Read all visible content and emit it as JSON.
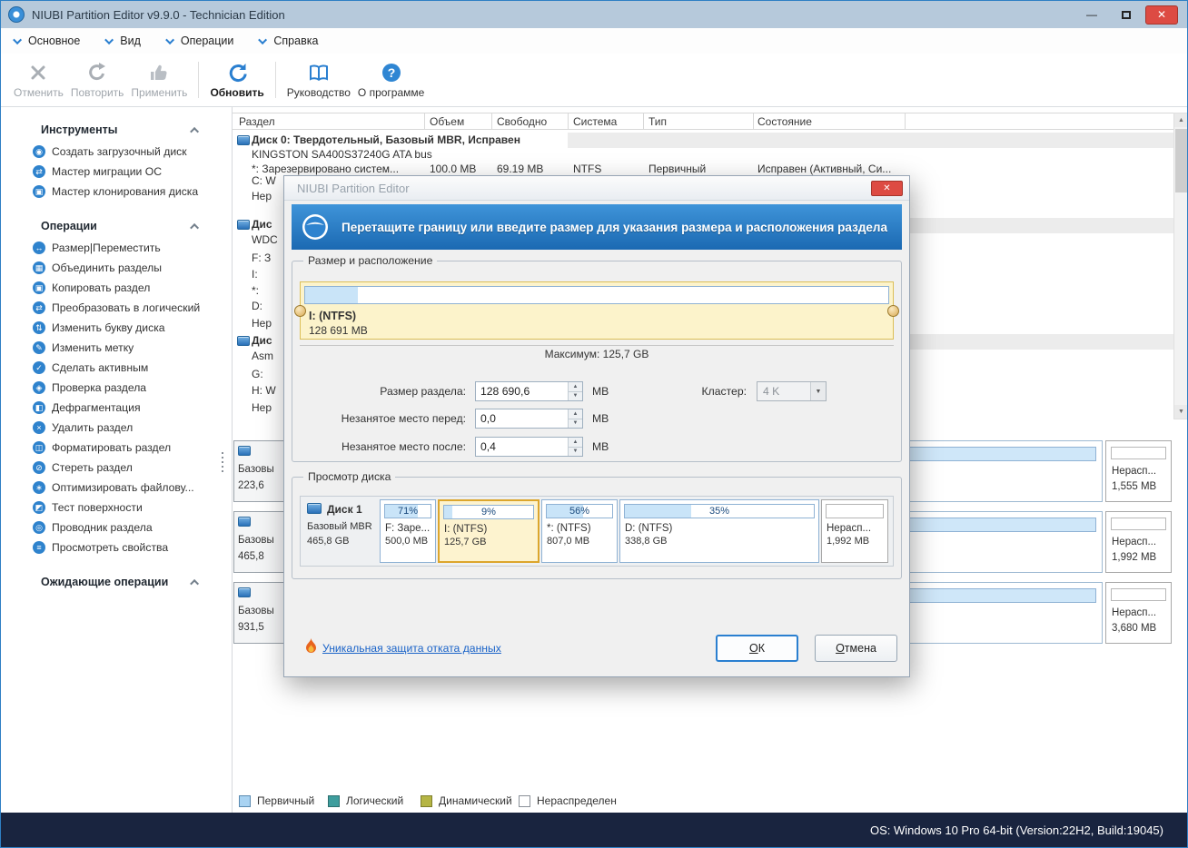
{
  "colors": {
    "accent_blue": "#2a7fd0",
    "banner_gradient_top": "#3f94d9",
    "banner_gradient_bottom": "#1b69b2",
    "selection_yellow": "#fdf3cf",
    "selection_border": "#dca62c",
    "primary_fill": "#c9e4f8",
    "legend_primary": "#a9d3f2",
    "legend_logical": "#3e9d9d",
    "legend_dynamic": "#b5b544",
    "legend_unallocated": "#ffffff",
    "statusbar_bg": "#19243f",
    "close_red": "#dd4b43"
  },
  "window": {
    "title": "NIUBI Partition Editor v9.9.0 - Technician Edition",
    "status": "OS: Windows 10 Pro 64-bit (Version:22H2, Build:19045)"
  },
  "menu": {
    "items": [
      "Основное",
      "Вид",
      "Операции",
      "Справка"
    ]
  },
  "toolbar": {
    "undo": "Отменить",
    "redo": "Повторить",
    "apply": "Применить",
    "refresh": "Обновить",
    "manual": "Руководство",
    "about": "О программе"
  },
  "sidebar": {
    "tools_title": "Инструменты",
    "tools": [
      "Создать загрузочный диск",
      "Мастер миграции ОС",
      "Мастер клонирования диска"
    ],
    "ops_title": "Операции",
    "ops": [
      "Размер|Переместить",
      "Объединить разделы",
      "Копировать раздел",
      "Преобразовать в логический",
      "Изменить букву диска",
      "Изменить метку",
      "Сделать активным",
      "Проверка раздела",
      "Дефрагментация",
      "Удалить раздел",
      "Форматировать раздел",
      "Стереть раздел",
      "Оптимизировать файлову...",
      "Тест поверхности",
      "Проводник раздела",
      "Просмотреть свойства"
    ],
    "pending_title": "Ожидающие операции"
  },
  "table": {
    "columns": [
      "Раздел",
      "Объем",
      "Свободно",
      "Система",
      "Тип",
      "Состояние"
    ],
    "disk0_title": "Диск 0: Твердотельный, Базовый MBR, Исправен",
    "disk0_subtitle": "KINGSTON SA400S37240G ATA bus",
    "row1": {
      "partition": "*: Зарезервировано систем...",
      "volume": "100.0 MB",
      "free": "69.19 MB",
      "system": "NTFS",
      "type": "Первичный",
      "status": "Исправен (Активный, Си..."
    },
    "fragments": [
      "C: W",
      "Нер",
      "Дис",
      "WDC",
      "F: З",
      "I:",
      "*:",
      "D:",
      "Нер",
      "Дис",
      "Asm",
      "G:",
      "H: W",
      "Нер"
    ]
  },
  "diskmap": {
    "left_blocks": [
      {
        "type": "Базовы",
        "size": "223,6"
      },
      {
        "type": "Базовы",
        "size": "465,8"
      },
      {
        "type": "Базовы",
        "size": "931,5"
      }
    ],
    "right_blocks": [
      {
        "name": "Нерасп...",
        "size": "1,555 MB"
      },
      {
        "name": "Нерасп...",
        "size": "1,992 MB"
      },
      {
        "name": "Нерасп...",
        "size": "3,680 MB"
      }
    ]
  },
  "legend": {
    "primary": "Первичный",
    "logical": "Логический",
    "dynamic": "Динамический",
    "unallocated": "Нераспределен"
  },
  "dialog": {
    "title": "NIUBI Partition Editor",
    "banner": "Перетащите границу или введите размер для указания размера и расположения раздела",
    "size_group": "Размер и расположение",
    "slider_label": "I: (NTFS)",
    "slider_size": "128 691 MB",
    "maximum": "Максимум: 125,7 GB",
    "field_size_label": "Размер раздела:",
    "field_size_value": "128 690,6",
    "field_before_label": "Незанятое место перед:",
    "field_before_value": "0,0",
    "field_after_label": "Незанятое место после:",
    "field_after_value": "0,4",
    "unit": "MB",
    "cluster_label": "Кластер:",
    "cluster_value": "4 K",
    "view_group": "Просмотр диска",
    "disk_name": "Диск 1",
    "disk_type": "Базовый MBR",
    "disk_size": "465,8 GB",
    "partitions": [
      {
        "percent": "71%",
        "name": "F: Заре...",
        "size": "500,0 MB"
      },
      {
        "percent": "9%",
        "name": "I: (NTFS)",
        "size": "125,7 GB"
      },
      {
        "percent": "56%",
        "name": "*: (NTFS)",
        "size": "807,0 MB"
      },
      {
        "percent": "35%",
        "name": "D: (NTFS)",
        "size": "338,8 GB"
      },
      {
        "percent": "",
        "name": "Нерасп...",
        "size": "1,992 MB"
      }
    ],
    "link": "Уникальная защита отката данных",
    "ok": "ОК",
    "cancel": "Отмена"
  }
}
